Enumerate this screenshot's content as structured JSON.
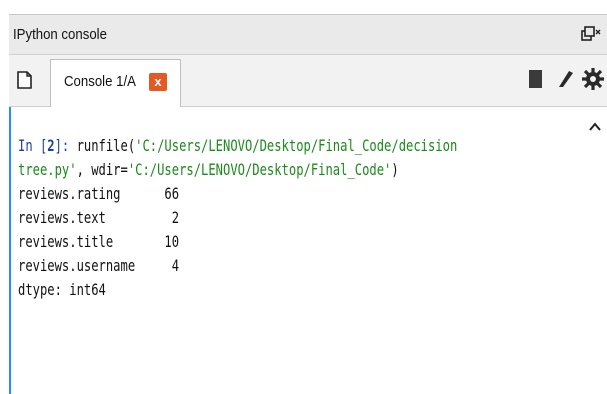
{
  "window": {
    "title": "IPython console"
  },
  "tabs": [
    {
      "label": "Console 1/A",
      "close_glyph": "x"
    }
  ],
  "icons": {
    "undock": "undock-icon",
    "new_console": "new-console-icon",
    "tab_close": "close-icon",
    "stop": "stop-icon",
    "clear": "brush-icon",
    "options": "gear-icon",
    "scroll_up": "chevron-up-icon"
  },
  "colors": {
    "prompt": "#1c3fa6",
    "string": "#1a8a1a",
    "tab_close_bg": "#e25a24",
    "focus_border": "#1e90ff"
  },
  "console": {
    "prompt_in": "In [",
    "prompt_num": "2",
    "prompt_end": "]: ",
    "func_call": "runfile(",
    "arg1": "'C:/Users/LENOVO/Desktop/Final_Code/decision",
    "arg1_cont": "tree.py'",
    "sep": ", wdir=",
    "arg2": "'C:/Users/LENOVO/Desktop/Final_Code'",
    "close_paren": ")",
    "rows": [
      {
        "key": "reviews.rating",
        "value": "66"
      },
      {
        "key": "reviews.text",
        "value": "2"
      },
      {
        "key": "reviews.title",
        "value": "10"
      },
      {
        "key": "reviews.username",
        "value": "4"
      }
    ],
    "dtype": "dtype: int64"
  }
}
